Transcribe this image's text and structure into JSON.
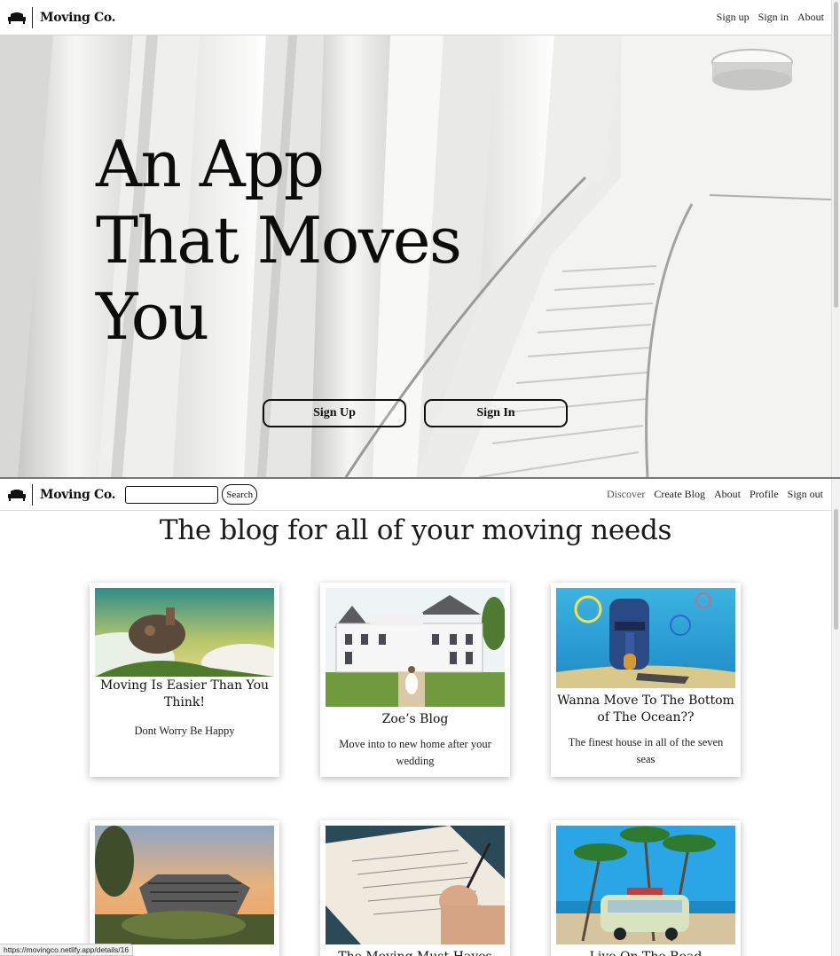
{
  "top": {
    "brand": "Moving Co.",
    "nav": [
      "Sign up",
      "Sign in",
      "About"
    ],
    "hero_title": "An App That Moves You",
    "sign_up": "Sign Up",
    "sign_in": "Sign In"
  },
  "bottom": {
    "brand": "Moving Co.",
    "search": {
      "value": "",
      "button": "Search"
    },
    "nav": [
      "Discover",
      "Create Blog",
      "About",
      "Profile",
      "Sign out"
    ],
    "heading": "The blog for all of your moving needs",
    "cards": [
      {
        "title": "Moving Is Easier Than You Think!",
        "desc": "Dont Worry Be Happy"
      },
      {
        "title": "Zoe’s Blog",
        "desc": "Move into to new home after your wedding"
      },
      {
        "title": "Wanna Move To The Bottom of The Ocean??",
        "desc": "The finest house in all of the seven seas"
      },
      {
        "title": "",
        "desc": ""
      },
      {
        "title": "The Moving Must-Haves",
        "desc": ""
      },
      {
        "title": "Live On The Road",
        "desc": ""
      }
    ]
  },
  "status_url": "https://movingco.netlify.app/details/16",
  "icons": {
    "logo": "couch-icon"
  }
}
